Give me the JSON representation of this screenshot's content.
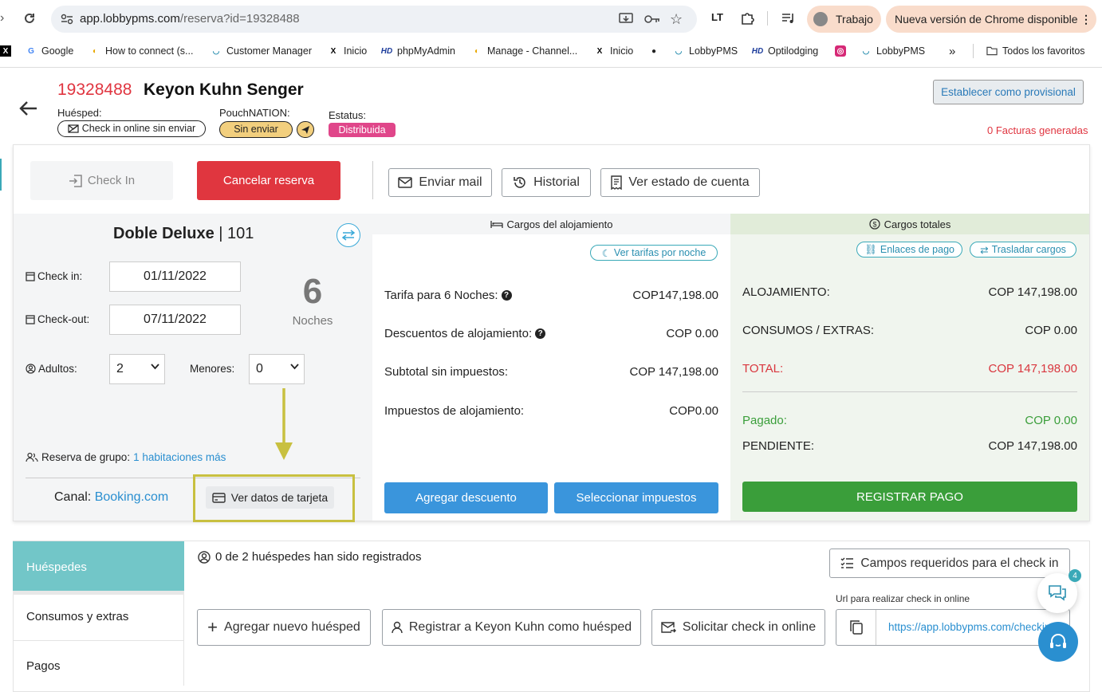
{
  "browser": {
    "url_host": "app.lobbypms.com",
    "url_path": "/reserva?id=19328488",
    "profile_label": "Trabajo",
    "update_label": "Nueva versión de Chrome disponible",
    "bookmarks": [
      {
        "label": "Google"
      },
      {
        "label": "How to connect (s..."
      },
      {
        "label": "Customer Manager"
      },
      {
        "label": "Inicio"
      },
      {
        "label": "phpMyAdmin"
      },
      {
        "label": "Manage - Channel..."
      },
      {
        "label": "Inicio"
      },
      {
        "label": "LobbyPMS"
      },
      {
        "label": "Optilodging"
      },
      {
        "label": "LobbyPMS"
      }
    ],
    "more_bookmarks": "»",
    "all_bookmarks": "Todos los favoritos"
  },
  "reservation": {
    "id": "19328488",
    "guest_name": "Keyon Kuhn Senger",
    "huesped_label": "Huésped:",
    "checkin_online_tag": "Check in online sin enviar",
    "pouch_label": "PouchNATION:",
    "pouch_tag": "Sin enviar",
    "estatus_label": "Estatus:",
    "estatus_tag": "Distribuida",
    "provisional_button": "Establecer como provisional",
    "facturas": "0 Facturas generadas",
    "id_color": "#e03540"
  },
  "actions": {
    "check_in": "Check In",
    "cancel": "Cancelar reserva",
    "email": "Enviar mail",
    "history": "Historial",
    "account": "Ver estado de cuenta"
  },
  "room": {
    "type": "Doble Deluxe",
    "separator": " | ",
    "number": "101",
    "checkin_label": "Check in:",
    "checkin_value": "01/11/2022",
    "checkout_label": "Check-out:",
    "checkout_value": "07/11/2022",
    "nights_count": "6",
    "nights_label": "Noches",
    "adults_label": "Adultos:",
    "adults_value": "2",
    "minors_label": "Menores:",
    "minors_value": "0",
    "group_label": "Reserva de grupo:",
    "group_link": "1 habitaciones más",
    "canal_label": "Canal:",
    "canal_value": "Booking.com",
    "card_button": "Ver datos de tarjeta"
  },
  "lodging": {
    "header": "Cargos del alojamiento",
    "rates_link": "Ver tarifas por noche",
    "rows": [
      {
        "label": "Tarifa para 6 Noches:",
        "value": "COP147,198.00"
      },
      {
        "label": "Descuentos de alojamiento:",
        "value": "COP 0.00"
      },
      {
        "label": "Subtotal sin impuestos:",
        "value": "COP 147,198.00"
      },
      {
        "label": "Impuestos de alojamiento:",
        "value": "COP0.00"
      }
    ],
    "discount_button": "Agregar descuento",
    "taxes_button": "Seleccionar impuestos"
  },
  "totals": {
    "header": "Cargos totales",
    "payment_links": "Enlaces de pago",
    "transfer": "Trasladar cargos",
    "rows": [
      {
        "label": "ALOJAMIENTO:",
        "value": "COP 147,198.00"
      },
      {
        "label": "CONSUMOS / EXTRAS:",
        "value": "COP 0.00"
      },
      {
        "label": "TOTAL:",
        "value": "COP 147,198.00"
      },
      {
        "label": "Pagado:",
        "value": "COP 0.00"
      },
      {
        "label": "PENDIENTE:",
        "value": "COP 147,198.00"
      }
    ],
    "register_button": "REGISTRAR PAGO",
    "total_color": "#d9363e",
    "paid_color": "#3a9e3a"
  },
  "bottom": {
    "tabs": [
      "Huéspedes",
      "Consumos y extras",
      "Pagos"
    ],
    "guests_status": "0 de 2 huéspedes han sido registrados",
    "required_fields": "Campos requeridos para el check in",
    "url_label": "Url para realizar check in online",
    "add_guest": "Agregar nuevo huésped",
    "register_guest": "Registrar a Keyon Kuhn como huésped",
    "request_checkin": "Solicitar check in online",
    "checkin_url": "https://app.lobbypms.com/checkin",
    "chat_badge": "4"
  }
}
